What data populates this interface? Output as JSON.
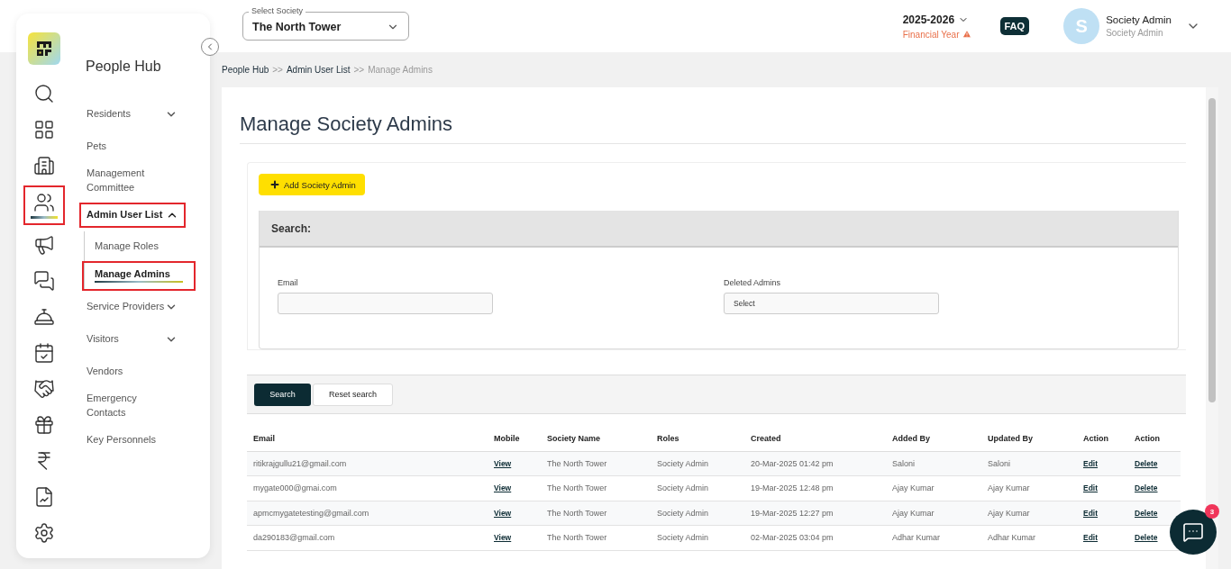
{
  "rail": [
    {
      "kind": "search",
      "selected": false
    },
    {
      "kind": "dashboard",
      "selected": false
    },
    {
      "kind": "building",
      "selected": false
    },
    {
      "kind": "people",
      "selected": true
    },
    {
      "kind": "megaphone",
      "selected": false
    },
    {
      "kind": "chat",
      "selected": false
    },
    {
      "kind": "desk",
      "selected": false
    },
    {
      "kind": "calendar",
      "selected": false
    },
    {
      "kind": "handshake",
      "selected": false
    },
    {
      "kind": "gift",
      "selected": false
    },
    {
      "kind": "rupee",
      "selected": false
    },
    {
      "kind": "report",
      "selected": false
    },
    {
      "kind": "settings",
      "selected": false
    }
  ],
  "nav": {
    "title": "People Hub",
    "items": [
      {
        "label": "Residents",
        "expanded": false,
        "selected": false
      },
      {
        "label": "Pets",
        "selected": false
      },
      {
        "label": "Management Committee",
        "selected": false
      },
      {
        "label": "Admin User List",
        "expanded": true,
        "selected": true,
        "children": [
          {
            "label": "Manage Roles",
            "selected": false
          },
          {
            "label": "Manage Admins",
            "selected": true
          }
        ]
      },
      {
        "label": "Service Providers",
        "expanded": false,
        "selected": false
      },
      {
        "label": "Visitors",
        "expanded": false,
        "selected": false
      },
      {
        "label": "Vendors",
        "selected": false
      },
      {
        "label": "Emergency Contacts",
        "selected": false
      },
      {
        "label": "Key Personnels",
        "selected": false
      }
    ]
  },
  "header": {
    "society_select": {
      "label": "Select Society",
      "value": "The North Tower"
    },
    "year": "2025-2026",
    "year_note": "Financial Year",
    "faq": "FAQ",
    "avatar": "S",
    "user_name": "Society Admin",
    "user_role": "Society Admin"
  },
  "breadcrumb": [
    {
      "label": "People Hub",
      "current": false
    },
    {
      "label": "Admin User List",
      "current": false
    },
    {
      "label": "Manage Admins",
      "current": true
    }
  ],
  "breadcrumb_separator": ">>",
  "title": "Manage Society Admins",
  "add_button": "Add Society Admin",
  "search_title": "Search:",
  "fields": [
    {
      "kind": "input",
      "label": "Email"
    },
    {
      "kind": "select",
      "label": "Deleted Admins",
      "value": "Select"
    }
  ],
  "search_button": "Search",
  "reset_button": "Reset search",
  "table": {
    "columns": [
      {
        "label": "Email",
        "kind": "text"
      },
      {
        "label": "Mobile",
        "kind": "link"
      },
      {
        "label": "Society Name",
        "kind": "text"
      },
      {
        "label": "Roles",
        "kind": "text"
      },
      {
        "label": "Created",
        "kind": "text"
      },
      {
        "label": "Added By",
        "kind": "text"
      },
      {
        "label": "Updated By",
        "kind": "text"
      },
      {
        "label": "Action",
        "kind": "link"
      },
      {
        "label": "Action",
        "kind": "link"
      }
    ],
    "rows": [
      [
        "ritikrajgullu21@gmail.com",
        "View",
        "The North Tower",
        "Society Admin",
        "20-Mar-2025 01:42 pm",
        "Saloni",
        "Saloni",
        "Edit",
        "Delete"
      ],
      [
        "mygate000@gmai.com",
        "View",
        "The North Tower",
        "Society Admin",
        "19-Mar-2025 12:48 pm",
        "Ajay Kumar",
        "Ajay Kumar",
        "Edit",
        "Delete"
      ],
      [
        "apmcmygatetesting@gmail.com",
        "View",
        "The North Tower",
        "Society Admin",
        "19-Mar-2025 12:27 pm",
        "Ajay Kumar",
        "Ajay Kumar",
        "Edit",
        "Delete"
      ],
      [
        "da290183@gmail.com",
        "View",
        "The North Tower",
        "Society Admin",
        "02-Mar-2025 03:04 pm",
        "Adhar Kumar",
        "Adhar Kumar",
        "Edit",
        "Delete"
      ]
    ]
  },
  "chat_badge": "3"
}
